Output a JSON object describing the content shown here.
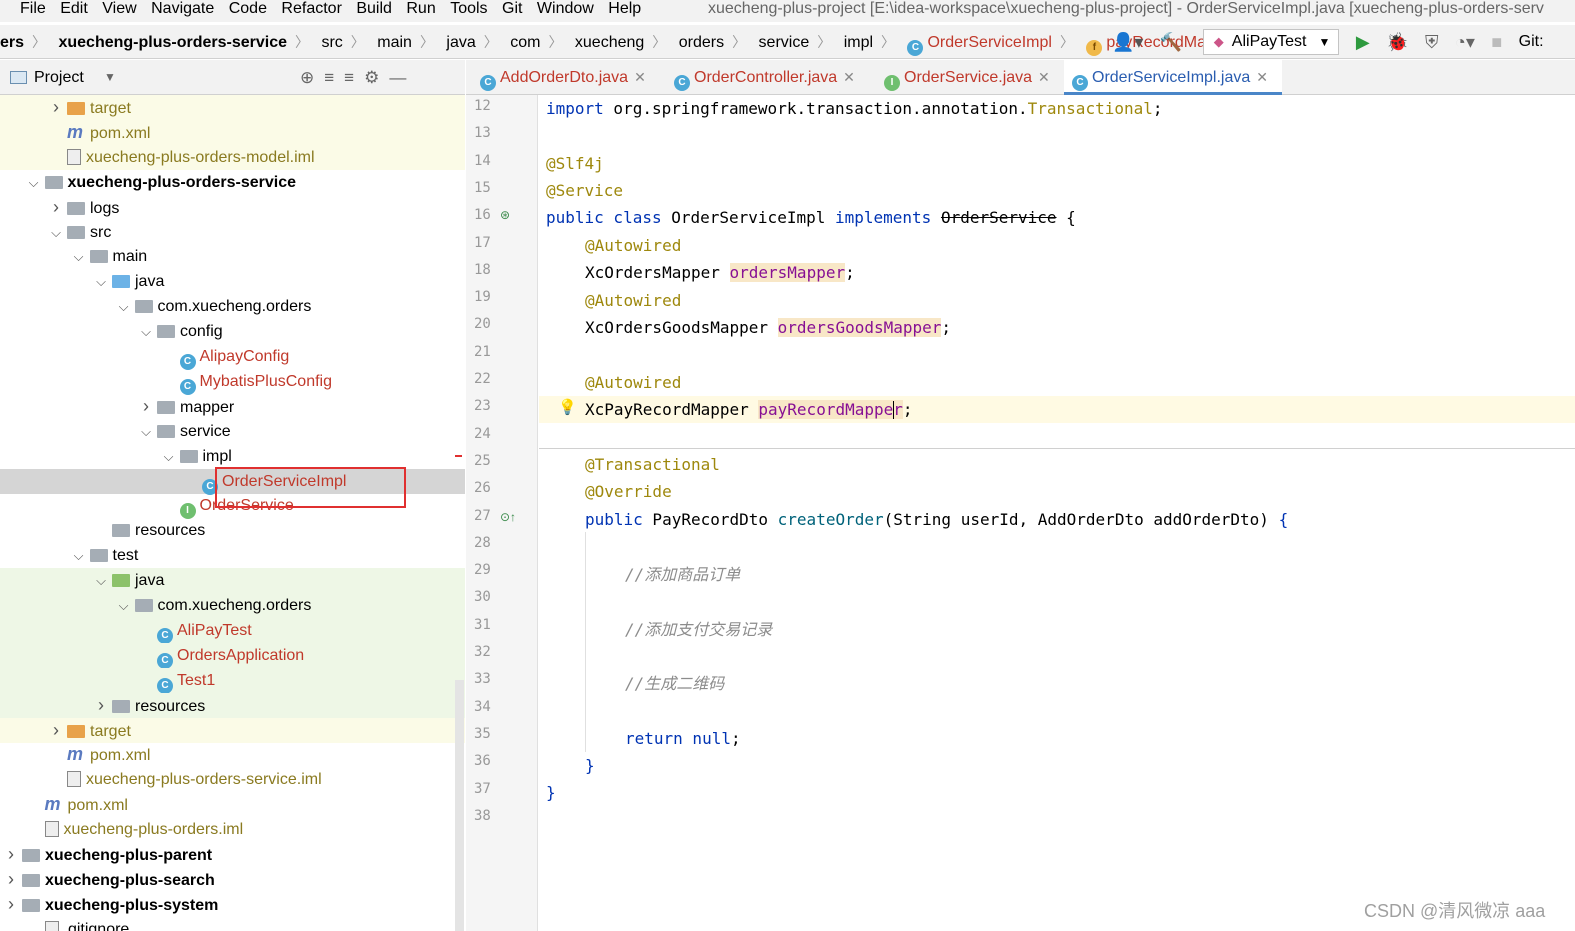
{
  "menu": [
    "File",
    "Edit",
    "View",
    "Navigate",
    "Code",
    "Refactor",
    "Build",
    "Run",
    "Tools",
    "Git",
    "Window",
    "Help"
  ],
  "window_title": "xuecheng-plus-project [E:\\idea-workspace\\xuecheng-plus-project] - OrderServiceImpl.java [xuecheng-plus-orders-serv",
  "breadcrumbs": [
    {
      "label": "ers",
      "style": "bold"
    },
    {
      "label": "xuecheng-plus-orders-service",
      "style": "bold"
    },
    {
      "label": "src"
    },
    {
      "label": "main"
    },
    {
      "label": "java"
    },
    {
      "label": "com"
    },
    {
      "label": "xuecheng"
    },
    {
      "label": "orders"
    },
    {
      "label": "service"
    },
    {
      "label": "impl"
    },
    {
      "label": "OrderServiceImpl",
      "icon": "c",
      "style": "red"
    },
    {
      "label": "payRecordMapper",
      "icon": "f",
      "style": "red"
    }
  ],
  "run_config": "AliPayTest",
  "git_label": "Git:",
  "project_panel_title": "Project",
  "tree": [
    {
      "label": "target",
      "indent": 1,
      "arrow": "›",
      "icon": "folder-orange",
      "style": "olive",
      "bg": "yel"
    },
    {
      "label": "pom.xml",
      "indent": 1,
      "arrow": "",
      "icon": "maven",
      "style": "olive",
      "bg": "yel"
    },
    {
      "label": "xuecheng-plus-orders-model.iml",
      "indent": 1,
      "arrow": "",
      "icon": "file",
      "style": "olive",
      "bg": "yel"
    },
    {
      "label": "xuecheng-plus-orders-service",
      "indent": 0,
      "arrow": "⌄",
      "icon": "folder-gray",
      "style": "bold",
      "bg": ""
    },
    {
      "label": "logs",
      "indent": 1,
      "arrow": "›",
      "icon": "folder-gray",
      "style": "",
      "bg": ""
    },
    {
      "label": "src",
      "indent": 1,
      "arrow": "⌄",
      "icon": "folder-gray",
      "style": "",
      "bg": ""
    },
    {
      "label": "main",
      "indent": 2,
      "arrow": "⌄",
      "icon": "folder-gray",
      "style": "",
      "bg": ""
    },
    {
      "label": "java",
      "indent": 3,
      "arrow": "⌄",
      "icon": "folder-blue",
      "style": "",
      "bg": ""
    },
    {
      "label": "com.xuecheng.orders",
      "indent": 4,
      "arrow": "⌄",
      "icon": "folder-gray",
      "style": "",
      "bg": ""
    },
    {
      "label": "config",
      "indent": 5,
      "arrow": "⌄",
      "icon": "folder-gray",
      "style": "",
      "bg": ""
    },
    {
      "label": "AlipayConfig",
      "indent": 6,
      "arrow": "",
      "icon": "class",
      "style": "red",
      "bg": ""
    },
    {
      "label": "MybatisPlusConfig",
      "indent": 6,
      "arrow": "",
      "icon": "class",
      "style": "red",
      "bg": ""
    },
    {
      "label": "mapper",
      "indent": 5,
      "arrow": "›",
      "icon": "folder-gray",
      "style": "",
      "bg": ""
    },
    {
      "label": "service",
      "indent": 5,
      "arrow": "⌄",
      "icon": "folder-gray",
      "style": "",
      "bg": ""
    },
    {
      "label": "impl",
      "indent": 6,
      "arrow": "⌄",
      "icon": "folder-gray",
      "style": "",
      "bg": ""
    },
    {
      "label": "OrderServiceImpl",
      "indent": 7,
      "arrow": "",
      "icon": "class",
      "style": "red",
      "bg": "sel"
    },
    {
      "label": "OrderService",
      "indent": 6,
      "arrow": "",
      "icon": "interface",
      "style": "red",
      "bg": ""
    },
    {
      "label": "resources",
      "indent": 3,
      "arrow": "",
      "icon": "folder-res",
      "style": "",
      "bg": ""
    },
    {
      "label": "test",
      "indent": 2,
      "arrow": "⌄",
      "icon": "folder-gray",
      "style": "",
      "bg": ""
    },
    {
      "label": "java",
      "indent": 3,
      "arrow": "⌄",
      "icon": "folder-green",
      "style": "",
      "bg": "grn"
    },
    {
      "label": "com.xuecheng.orders",
      "indent": 4,
      "arrow": "⌄",
      "icon": "folder-gray",
      "style": "",
      "bg": "grn"
    },
    {
      "label": "AliPayTest",
      "indent": 5,
      "arrow": "",
      "icon": "class",
      "style": "red",
      "bg": "grn"
    },
    {
      "label": "OrdersApplication",
      "indent": 5,
      "arrow": "",
      "icon": "class",
      "style": "red",
      "bg": "grn"
    },
    {
      "label": "Test1",
      "indent": 5,
      "arrow": "",
      "icon": "class",
      "style": "red",
      "bg": "grn"
    },
    {
      "label": "resources",
      "indent": 3,
      "arrow": "›",
      "icon": "folder-res",
      "style": "",
      "bg": "grn"
    },
    {
      "label": "target",
      "indent": 1,
      "arrow": "›",
      "icon": "folder-orange",
      "style": "olive",
      "bg": "yel"
    },
    {
      "label": "pom.xml",
      "indent": 1,
      "arrow": "",
      "icon": "maven",
      "style": "olive",
      "bg": ""
    },
    {
      "label": "xuecheng-plus-orders-service.iml",
      "indent": 1,
      "arrow": "",
      "icon": "file",
      "style": "olive",
      "bg": ""
    },
    {
      "label": "pom.xml",
      "indent": 0,
      "arrow": "",
      "icon": "maven",
      "style": "olive",
      "bg": ""
    },
    {
      "label": "xuecheng-plus-orders.iml",
      "indent": 0,
      "arrow": "",
      "icon": "file",
      "style": "olive",
      "bg": ""
    },
    {
      "label": "xuecheng-plus-parent",
      "indent": -1,
      "arrow": "›",
      "icon": "folder-gray",
      "style": "bold",
      "bg": ""
    },
    {
      "label": "xuecheng-plus-search",
      "indent": -1,
      "arrow": "›",
      "icon": "folder-gray",
      "style": "bold",
      "bg": ""
    },
    {
      "label": "xuecheng-plus-system",
      "indent": -1,
      "arrow": "›",
      "icon": "folder-gray",
      "style": "bold",
      "bg": ""
    },
    {
      "label": ".gitignore",
      "indent": 0,
      "arrow": "",
      "icon": "file",
      "style": "",
      "bg": ""
    }
  ],
  "editor_tabs": [
    {
      "label": "AddOrderDto.java",
      "icon": "c",
      "active": false
    },
    {
      "label": "OrderController.java",
      "icon": "c",
      "active": false
    },
    {
      "label": "OrderService.java",
      "icon": "i",
      "active": false
    },
    {
      "label": "OrderServiceImpl.java",
      "icon": "c",
      "active": true
    }
  ],
  "line_numbers": [
    "12",
    "13",
    "14",
    "15",
    "16",
    "17",
    "18",
    "19",
    "20",
    "21",
    "22",
    "23",
    "24",
    "25",
    "26",
    "27",
    "28",
    "29",
    "30",
    "31",
    "32",
    "33",
    "34",
    "35",
    "36",
    "37",
    "38"
  ],
  "code": {
    "l12_kw": "import",
    "l12_pkg": " org.springframework.transaction.annotation.",
    "l12_cls": "Transactional",
    "l12_end": ";",
    "l14": "@Slf4j",
    "l15": "@Service",
    "l16_kw1": "public class",
    "l16_name": " OrderServiceImpl ",
    "l16_kw2": "implements",
    "l16_sp": " ",
    "l16_iface": "OrderService",
    "l16_brace": " {",
    "l17": "@Autowired",
    "l18_type": "XcOrdersMapper ",
    "l18_field": "ordersMapper",
    "l18_end": ";",
    "l19": "@Autowired",
    "l20_type": "XcOrdersGoodsMapper ",
    "l20_field": "ordersGoodsMapper",
    "l20_end": ";",
    "l22": "@Autowired",
    "l23_type": "XcPayRecordMapper ",
    "l23_field": "payRecordMapper",
    "l23_end": ";",
    "l25": "@Transactional",
    "l26": "@Override",
    "l27_kw": "public",
    "l27_type": " PayRecordDto ",
    "l27_meth": "createOrder",
    "l27_params": "(String userId, AddOrderDto addOrderDto) ",
    "l27_brace": "{",
    "l29": "//添加商品订单",
    "l31": "//添加支付交易记录",
    "l33": "//生成二维码",
    "l35_kw": "return null",
    "l35_end": ";",
    "l36": "}",
    "l37": "}"
  },
  "watermark": "CSDN @清风微凉 aaa"
}
